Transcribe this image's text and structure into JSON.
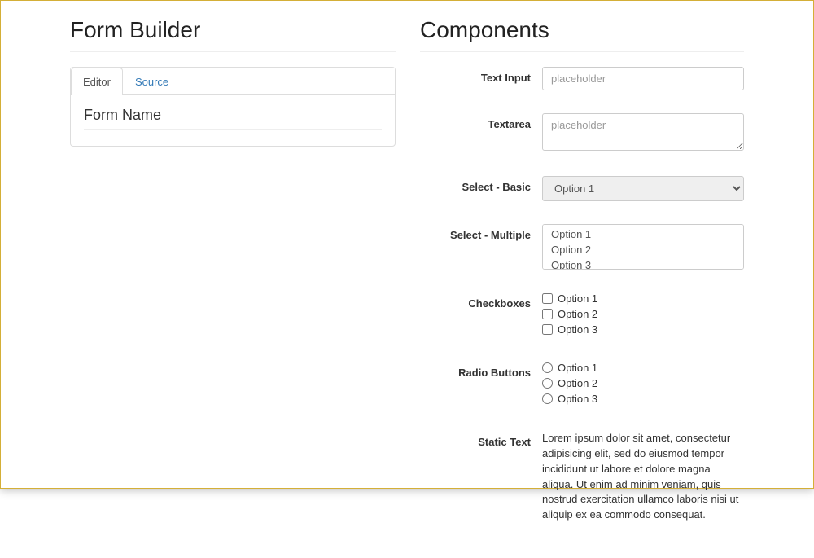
{
  "left": {
    "title": "Form Builder",
    "tabs": {
      "editor": "Editor",
      "source": "Source"
    },
    "form_name": "Form Name"
  },
  "right": {
    "title": "Components",
    "text_input": {
      "label": "Text Input",
      "placeholder": "placeholder"
    },
    "textarea": {
      "label": "Textarea",
      "placeholder": "placeholder"
    },
    "select_basic": {
      "label": "Select - Basic",
      "option1": "Option 1"
    },
    "select_multi": {
      "label": "Select - Multiple",
      "option1": "Option 1",
      "option2": "Option 2",
      "option3": "Option 3"
    },
    "checkboxes": {
      "label": "Checkboxes",
      "option1": "Option 1",
      "option2": "Option 2",
      "option3": "Option 3"
    },
    "radios": {
      "label": "Radio Buttons",
      "option1": "Option 1",
      "option2": "Option 2",
      "option3": "Option 3"
    },
    "static": {
      "label": "Static Text",
      "text": "Lorem ipsum dolor sit amet, consectetur adipisicing elit, sed do eiusmod tempor incididunt ut labore et dolore magna aliqua. Ut enim ad minim veniam, quis nostrud exercitation ullamco laboris nisi ut aliquip ex ea commodo consequat."
    }
  }
}
